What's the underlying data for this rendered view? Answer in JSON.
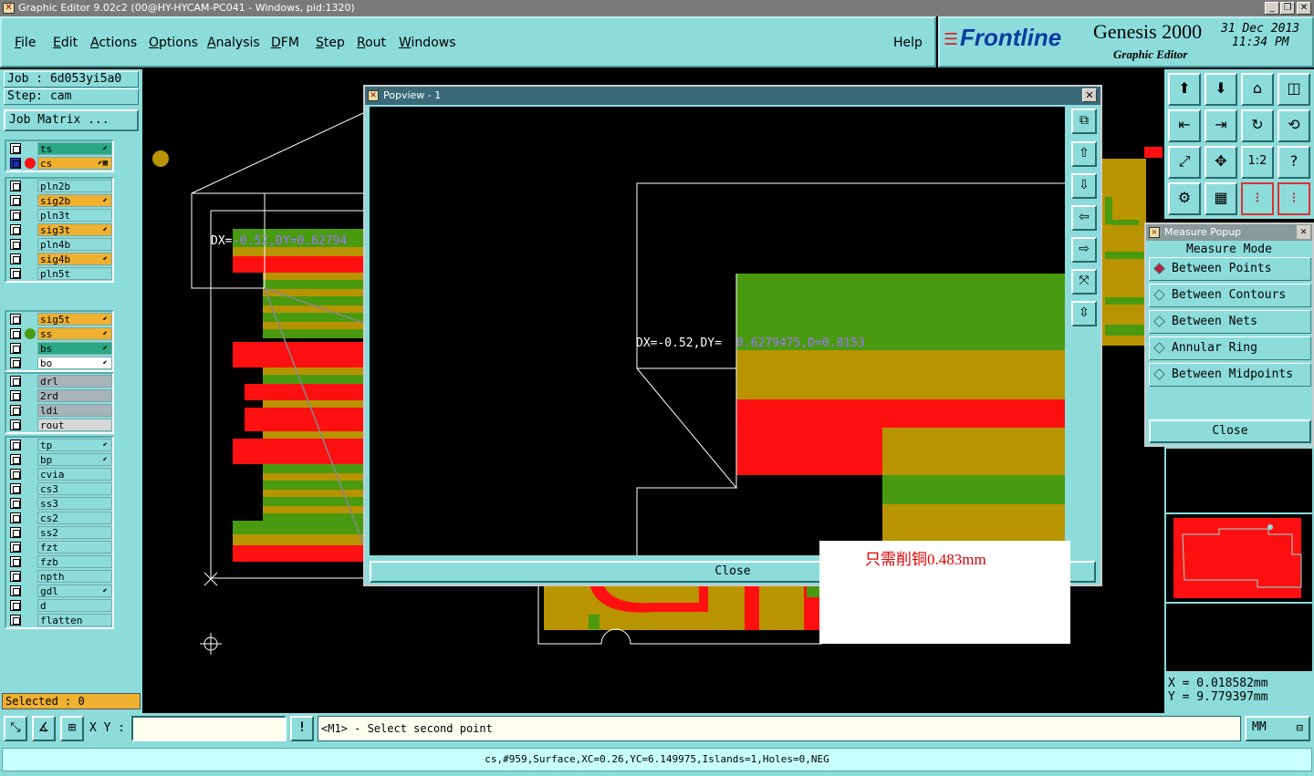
{
  "window": {
    "title": "Graphic Editor 9.02c2 (00@HY-HYCAM-PC041 - Windows, pid:1320)",
    "controls": [
      "_",
      "❐",
      "✕"
    ]
  },
  "menu": {
    "items": [
      {
        "label": "File",
        "ul": "F",
        "rest": "ile"
      },
      {
        "label": "Edit",
        "ul": "E",
        "rest": "dit"
      },
      {
        "label": "Actions",
        "ul": "A",
        "rest": "ctions"
      },
      {
        "label": "Options",
        "ul": "O",
        "rest": "ptions"
      },
      {
        "label": "Analysis",
        "ul": "A",
        "rest": "nalysis"
      },
      {
        "label": "DFM",
        "ul": "D",
        "rest": "FM"
      },
      {
        "label": "Step",
        "ul": "S",
        "rest": "tep"
      },
      {
        "label": "Rout",
        "ul": "R",
        "rest": "out"
      },
      {
        "label": "Windows",
        "ul": "W",
        "rest": "indows"
      }
    ],
    "help": "Help"
  },
  "branding": {
    "logo": "Frontline",
    "product": "Genesis 2000",
    "subtitle": "Graphic Editor",
    "date": "31 Dec 2013",
    "time": "11:34 PM"
  },
  "job": {
    "job_label": "Job  : 6d053yi5a0",
    "step_label": "Step: cam",
    "matrix_button": "Job Matrix ..."
  },
  "layer_groups": [
    [
      {
        "name": "ts",
        "color": "#2aa884",
        "tag": "⬋"
      },
      {
        "name": "cs",
        "color": "#f0b030",
        "tag": "⬋▦",
        "active": true
      }
    ],
    [
      {
        "name": "pln2b",
        "color": "#8ddcdc"
      },
      {
        "name": "sig2b",
        "color": "#f0b030",
        "tag": "⬋"
      },
      {
        "name": "pln3t",
        "color": "#8ddcdc"
      },
      {
        "name": "sig3t",
        "color": "#f0b030",
        "tag": "⬋"
      },
      {
        "name": "pln4b",
        "color": "#8ddcdc"
      },
      {
        "name": "sig4b",
        "color": "#f0b030",
        "tag": "⬋"
      },
      {
        "name": "pln5t",
        "color": "#8ddcdc"
      }
    ],
    [
      {
        "name": "sig5t",
        "color": "#f0b030",
        "tag": "⬋"
      },
      {
        "name": "ss",
        "color": "#f0b030",
        "tag": "⬋",
        "green": true
      },
      {
        "name": "bs",
        "color": "#2aa884",
        "tag": "⬋"
      },
      {
        "name": "bo",
        "color": "#ffffff",
        "tag": "⬋"
      }
    ],
    [
      {
        "name": "drl",
        "color": "#a8b4b8"
      },
      {
        "name": "2rd",
        "color": "#a8b4b8"
      },
      {
        "name": "ldi",
        "color": "#a8b4b8"
      },
      {
        "name": "rout",
        "color": "#d8d8d8"
      }
    ],
    [
      {
        "name": "tp",
        "color": "#8ddcdc",
        "tag": "⬋"
      },
      {
        "name": "bp",
        "color": "#8ddcdc",
        "tag": "⬋"
      },
      {
        "name": "cvia",
        "color": "#8ddcdc"
      },
      {
        "name": "cs3",
        "color": "#8ddcdc"
      },
      {
        "name": "ss3",
        "color": "#8ddcdc"
      },
      {
        "name": "cs2",
        "color": "#8ddcdc"
      },
      {
        "name": "ss2",
        "color": "#8ddcdc"
      },
      {
        "name": "fzt",
        "color": "#8ddcdc"
      },
      {
        "name": "fzb",
        "color": "#8ddcdc"
      },
      {
        "name": "npth",
        "color": "#8ddcdc"
      },
      {
        "name": "gdl",
        "color": "#8ddcdc",
        "tag": "⬋"
      },
      {
        "name": "d",
        "color": "#8ddcdc"
      },
      {
        "name": "flatten",
        "color": "#8ddcdc"
      }
    ]
  ],
  "selected": "Selected : 0",
  "canvas": {
    "measure_text_prefix": "DX=",
    "measure_text_value": "-0.52,DY=0.62794"
  },
  "popview": {
    "title": "Popview - 1",
    "measure_white": "DX=-0.52,DY=",
    "measure_purple": "0.6279475,D=0.8153",
    "close": "Close"
  },
  "note": "只需削铜0.483mm",
  "measure_popup": {
    "title": "Measure Popup",
    "mode_label": "Measure Mode",
    "options": [
      "Between Points",
      "Between Contours",
      "Between Nets",
      "Annular Ring",
      "Between Midpoints"
    ],
    "selected_index": 0,
    "close": "Close"
  },
  "coords": {
    "x": "X  =  0.018582mm",
    "y": "Y  =  9.779397mm"
  },
  "bottom": {
    "xy_label": "X Y :",
    "xy_value": "",
    "prompt": "<M1> - Select second point",
    "units": "MM"
  },
  "status": "cs,#959,Surface,XC=0.26,YC=6.149975,Islands=1,Holes=0,NEG",
  "colors": {
    "panel": "#8ddcdc",
    "copper_green": "#4a9a10",
    "copper_gold": "#b89400",
    "copper_red": "#ff1010",
    "measure_purple": "#a070ff"
  }
}
